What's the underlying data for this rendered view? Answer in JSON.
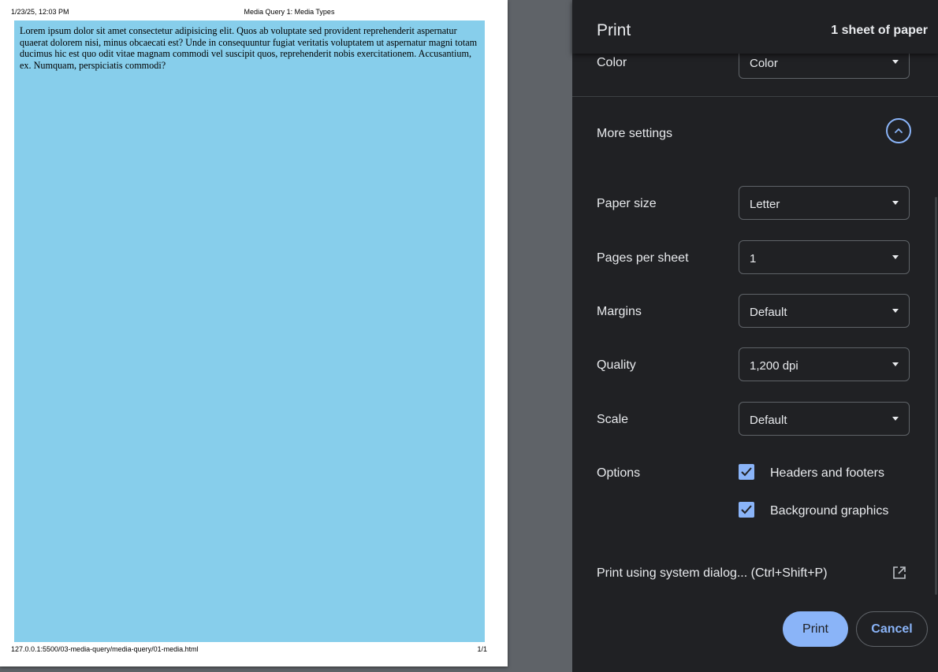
{
  "preview": {
    "header_date": "1/23/25, 12:03 PM",
    "header_title": "Media Query 1: Media Types",
    "body_text": "Lorem ipsum dolor sit amet consectetur adipisicing elit. Quos ab voluptate sed provident reprehenderit aspernatur quaerat dolorem nisi, minus obcaecati est? Unde in consequuntur fugiat veritatis voluptatem ut aspernatur magni totam ducimus hic est quo odit vitae magnam commodi vel suscipit quos, reprehenderit nobis exercitationem. Accusantium, ex. Numquam, perspiciatis commodi?",
    "footer_url": "127.0.0.1:5500/03-media-query/media-query/01-media.html",
    "footer_page": "1/1",
    "background_color": "#87ceeb"
  },
  "panel": {
    "title": "Print",
    "sheet_count": "1 sheet of paper",
    "color": {
      "label": "Color",
      "value": "Color"
    },
    "more_settings": {
      "label": "More settings",
      "icon": "chevron-up-icon"
    },
    "paper_size": {
      "label": "Paper size",
      "value": "Letter"
    },
    "pages_per_sheet": {
      "label": "Pages per sheet",
      "value": "1"
    },
    "margins": {
      "label": "Margins",
      "value": "Default"
    },
    "quality": {
      "label": "Quality",
      "value": "1,200 dpi"
    },
    "scale": {
      "label": "Scale",
      "value": "Default"
    },
    "options": {
      "label": "Options",
      "headers_footers": "Headers and footers",
      "background_graphics": "Background graphics"
    },
    "system_dialog": "Print using system dialog... (Ctrl+Shift+P)",
    "print_button": "Print",
    "cancel_button": "Cancel",
    "accent_color": "#8ab4f8"
  }
}
